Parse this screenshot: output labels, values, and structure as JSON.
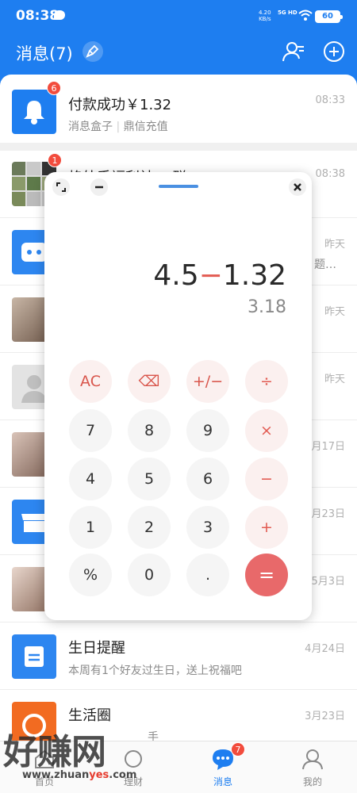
{
  "status_bar": {
    "time": "08:38",
    "net_speed": "4.20",
    "net_unit": "KB/s",
    "network": "5G HD",
    "battery": "60"
  },
  "header": {
    "title": "消息(7)"
  },
  "pinned": {
    "title": "付款成功￥1.32",
    "sub_a": "消息盒子",
    "sub_b": "鼎信充值",
    "time": "08:33",
    "badge": "6"
  },
  "list": [
    {
      "title": "格外手福利社14群",
      "time": "08:38",
      "badge": "1"
    },
    {
      "time": "昨天",
      "sub_tail": "题…"
    },
    {
      "time": "昨天"
    },
    {
      "time": "昨天"
    },
    {
      "time": "月17日"
    },
    {
      "time": "月23日"
    },
    {
      "time": "5月3日"
    },
    {
      "title": "生日提醒",
      "sub": "本周有1个好友过生日，送上祝福吧",
      "time": "4月24日"
    },
    {
      "title": "生活圈",
      "sub": "手",
      "time": "3月23日"
    }
  ],
  "calculator": {
    "expr_left": "4.5",
    "expr_op": "−",
    "expr_right": "1.32",
    "result": "3.18",
    "keys": [
      "AC",
      "⌫",
      "+/−",
      "÷",
      "7",
      "8",
      "9",
      "×",
      "4",
      "5",
      "6",
      "−",
      "1",
      "2",
      "3",
      "+",
      "%",
      "0",
      ".",
      "="
    ]
  },
  "tabs": [
    {
      "label": "首页",
      "icon": "home-icon"
    },
    {
      "label": "理财",
      "icon": "wealth-icon"
    },
    {
      "label": "消息",
      "icon": "message-icon",
      "badge": "7",
      "active": true
    },
    {
      "label": "我的",
      "icon": "profile-icon"
    }
  ],
  "watermark": {
    "big": "好赚网",
    "small_a": "www.zhuan",
    "small_b": "yes",
    "small_c": ".com"
  },
  "colors": {
    "brand": "#1e7ef0",
    "badge": "#f24c3d",
    "calc_accent": "#e25b52"
  }
}
